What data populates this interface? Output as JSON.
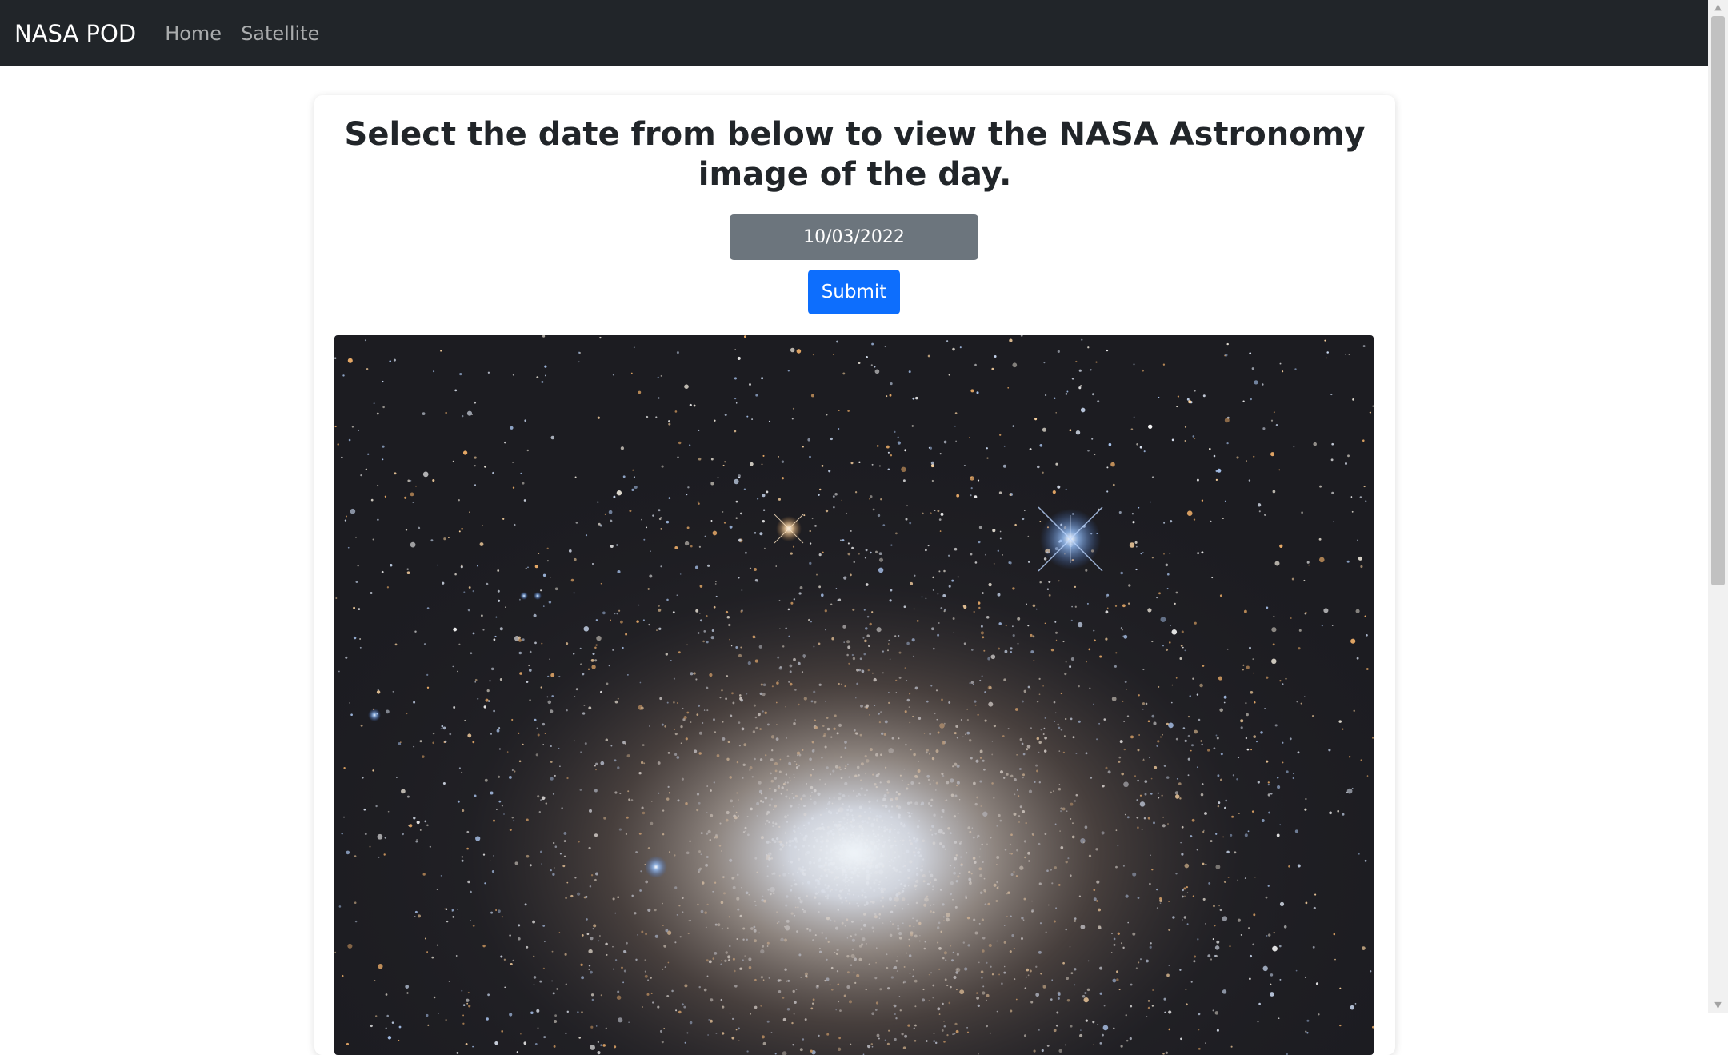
{
  "navbar": {
    "brand": "NASA POD",
    "links": [
      "Home",
      "Satellite"
    ]
  },
  "main": {
    "heading": "Select the date from below to view the NASA Astronomy image of the day.",
    "date_value": "10/03/2022",
    "submit_label": "Submit"
  },
  "colors": {
    "navbar_bg": "#212529",
    "date_input_bg": "#6c757d",
    "submit_bg": "#0d6efd"
  }
}
